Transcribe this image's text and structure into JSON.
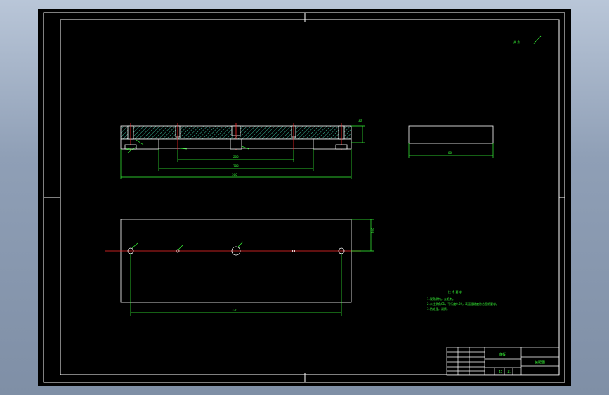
{
  "drawing": {
    "roughness_note": "✓",
    "roughness_label": "其 余",
    "dims": {
      "side_overall": "360",
      "side_inner": "288",
      "side_bottom": "200",
      "side_height": "30",
      "side_thread": "M4",
      "plan_width": "80",
      "plan_hole_span": "330",
      "front_length": "200"
    },
    "notes": {
      "title": "技 术 要 求",
      "items": [
        "1.锐角倒钝，去毛刺。",
        "2.未注倒角C1，平行度0.02，表面粗糙度符合图纸要求。",
        "3.热处理，调质。"
      ]
    },
    "title_block": {
      "name": "底板",
      "drawing_no": "装配图",
      "material": "45",
      "scale": "1:1"
    }
  }
}
